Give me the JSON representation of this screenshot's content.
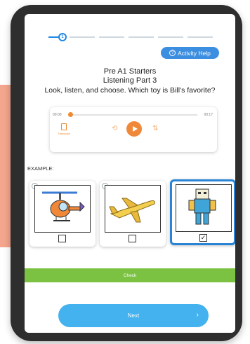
{
  "progress": {
    "current_step": "1",
    "total_steps": 6
  },
  "activity_help": {
    "label": "Activity Help",
    "icon": "question-circle-icon"
  },
  "header": {
    "level": "Pre A1 Starters",
    "part": "Listening Part 3",
    "question": "Look, listen, and choose. Which toy is Bill's favorite?"
  },
  "player": {
    "time_elapsed": "00:00",
    "time_total": "00:17",
    "progress": 0,
    "transcript_label": "Transcript",
    "icons": [
      "transcript-icon",
      "rewind-icon",
      "play-icon",
      "speed-icon"
    ]
  },
  "example_label": "EXAMPLE:",
  "options": [
    {
      "name": "helicopter",
      "selected": false,
      "checked": false
    },
    {
      "name": "airplane",
      "selected": false,
      "checked": false
    },
    {
      "name": "robot",
      "selected": true,
      "checked": true
    }
  ],
  "check_button": {
    "label": "Check"
  },
  "next_button": {
    "label": "Next"
  },
  "colors": {
    "accent_blue": "#3b8ee0",
    "player_orange": "#f0883a",
    "check_green": "#7cc242",
    "next_blue": "#43b2ee"
  }
}
